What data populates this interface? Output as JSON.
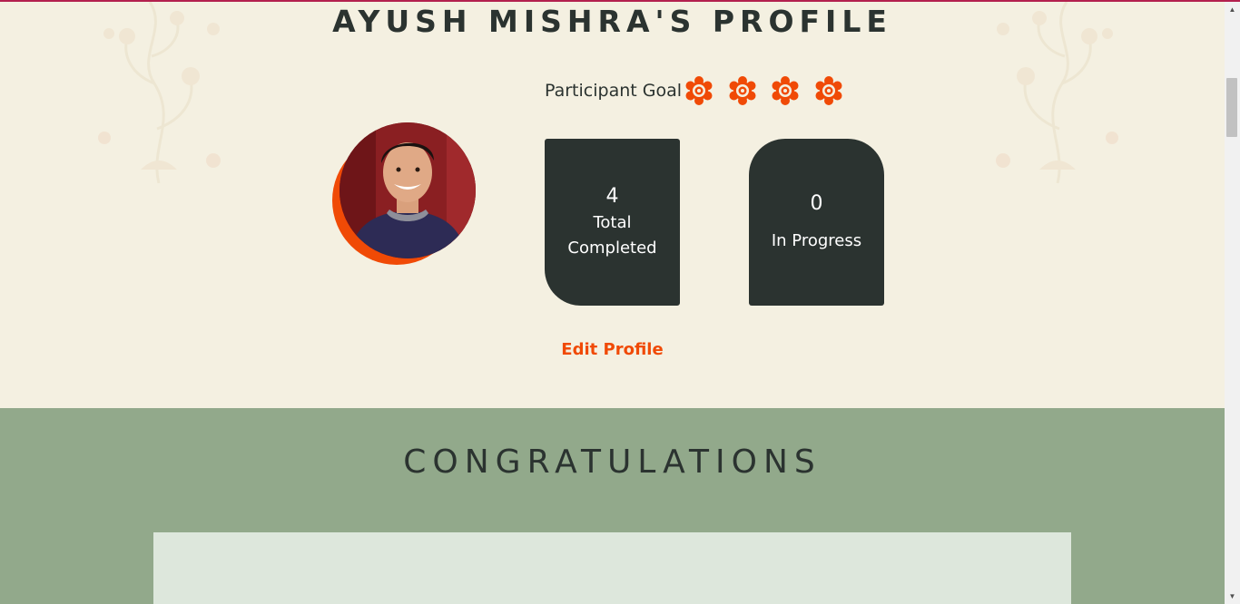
{
  "profile": {
    "title": "AYUSH MISHRA'S PROFILE",
    "goal_label": "Participant Goal",
    "goal_badges": 4,
    "badge_icon": "flower-badge-icon",
    "accent_color": "#f04a06",
    "dark_color": "#2b3330"
  },
  "stats": {
    "completed": {
      "value": "4",
      "label": "Total Completed"
    },
    "in_progress": {
      "value": "0",
      "label": "In Progress"
    }
  },
  "actions": {
    "edit_profile": "Edit Profile"
  },
  "congrats": {
    "title": "CONGRATULATIONS",
    "background": "#92a98b"
  }
}
